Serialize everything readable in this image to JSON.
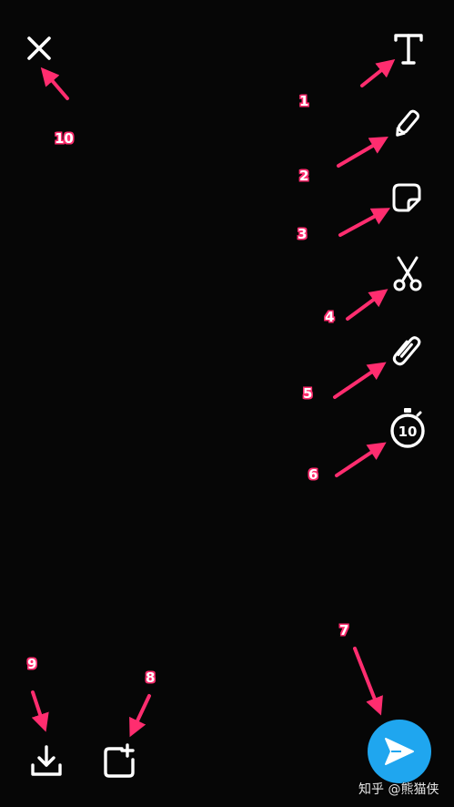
{
  "toolbar": {
    "close": {
      "icon": "close-icon"
    },
    "text": {
      "icon": "text-icon"
    },
    "pencil": {
      "icon": "pencil-icon"
    },
    "sticker": {
      "icon": "sticker-icon"
    },
    "scissors": {
      "icon": "scissors-icon"
    },
    "attach": {
      "icon": "paperclip-icon"
    },
    "timer": {
      "icon": "timer-icon",
      "value": "10"
    }
  },
  "bottom": {
    "save": {
      "icon": "download-icon"
    },
    "add_story": {
      "icon": "add-story-icon"
    },
    "send": {
      "icon": "send-icon",
      "color": "#1fa6ef"
    }
  },
  "annotations": {
    "color": "#ff2d6f",
    "labels": [
      "1",
      "2",
      "3",
      "4",
      "5",
      "6",
      "7",
      "8",
      "9",
      "10"
    ]
  },
  "watermark": "知乎 @熊猫侠"
}
